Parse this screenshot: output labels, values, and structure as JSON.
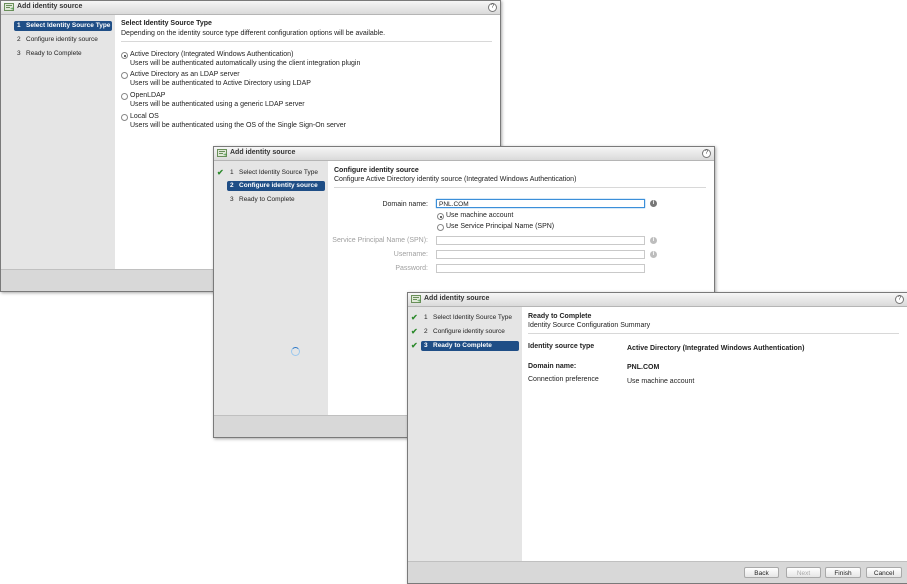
{
  "windows": [
    {
      "title": "Add identity source",
      "steps": [
        {
          "num": "1",
          "label": "Select Identity Source Type"
        },
        {
          "num": "2",
          "label": "Configure identity source"
        },
        {
          "num": "3",
          "label": "Ready to Complete"
        }
      ],
      "heading": "Select Identity Source Type",
      "subheading": "Depending on the identity source type different configuration options will be available.",
      "options": [
        {
          "label": "Active Directory (Integrated Windows Authentication)",
          "desc": "Users will be authenticated automatically using the client integration plugin",
          "selected": true
        },
        {
          "label": "Active Directory as an LDAP server",
          "desc": "Users will be authenticated to Active Directory using LDAP",
          "selected": false
        },
        {
          "label": "OpenLDAP",
          "desc": "Users will be authenticated using a generic LDAP server",
          "selected": false
        },
        {
          "label": "Local OS",
          "desc": "Users will be authenticated using the OS of the Single Sign-On server",
          "selected": false
        }
      ]
    },
    {
      "title": "Add identity source",
      "steps": [
        {
          "num": "1",
          "label": "Select Identity Source Type"
        },
        {
          "num": "2",
          "label": "Configure identity source"
        },
        {
          "num": "3",
          "label": "Ready to Complete"
        }
      ],
      "heading": "Configure identity source",
      "subheading": "Configure Active Directory identity source (Integrated Windows Authentication)",
      "domain_label": "Domain name:",
      "domain_value": "PNL.COM",
      "radio_machine": "Use machine account",
      "radio_spn": "Use Service Principal Name (SPN)",
      "spn_label": "Service Principal Name (SPN):",
      "username_label": "Username:",
      "password_label": "Password:"
    },
    {
      "title": "Add identity source",
      "steps": [
        {
          "num": "1",
          "label": "Select Identity Source Type"
        },
        {
          "num": "2",
          "label": "Configure identity source"
        },
        {
          "num": "3",
          "label": "Ready to Complete"
        }
      ],
      "heading": "Ready to Complete",
      "subheading": "Identity Source Configuration Summary",
      "summary": [
        {
          "key": "Identity source type",
          "value": "Active Directory (Integrated Windows Authentication)"
        },
        {
          "key": "Domain name:",
          "value": "PNL.COM"
        },
        {
          "key": "Connection preference",
          "value": "Use machine account"
        }
      ],
      "buttons": {
        "back": "Back",
        "next": "Next",
        "finish": "Finish",
        "cancel": "Cancel"
      }
    }
  ],
  "help_glyph": "?",
  "info_glyph": "i",
  "check_glyph": "✔"
}
